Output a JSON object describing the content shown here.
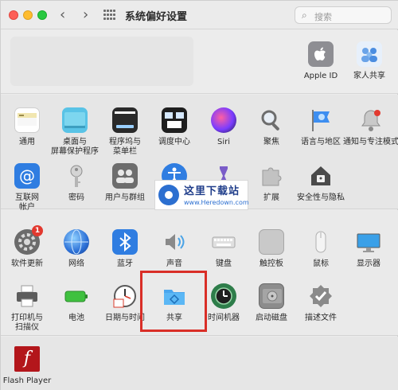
{
  "window": {
    "title": "系统偏好设置",
    "back": "‹",
    "forward": "›"
  },
  "search": {
    "placeholder": "搜索"
  },
  "account": [
    {
      "label": "Apple ID",
      "icon": "apple-icon"
    },
    {
      "label": "家人共享",
      "icon": "family-icon"
    }
  ],
  "row1": [
    {
      "label": "通用",
      "icon": "general-icon"
    },
    {
      "label": "桌面与\n屏幕保护程序",
      "icon": "desktop-icon"
    },
    {
      "label": "程序坞与\n菜单栏",
      "icon": "dock-icon"
    },
    {
      "label": "调度中心",
      "icon": "mission-control-icon"
    },
    {
      "label": "Siri",
      "icon": "siri-icon"
    },
    {
      "label": "聚焦",
      "icon": "spotlight-icon"
    },
    {
      "label": "语言与地区",
      "icon": "flag-icon"
    },
    {
      "label": "通知与专注模式",
      "icon": "bell-icon"
    }
  ],
  "row2": [
    {
      "label": "互联网\n帐户",
      "icon": "at-icon"
    },
    {
      "label": "密码",
      "icon": "key-icon"
    },
    {
      "label": "用户与群组",
      "icon": "users-icon"
    },
    {
      "label": "",
      "icon": "accessibility-icon"
    },
    {
      "label": "",
      "icon": "screen-time-icon"
    },
    {
      "label": "扩展",
      "icon": "puzzle-icon"
    },
    {
      "label": "安全性与隐私",
      "icon": "house-lock-icon"
    }
  ],
  "row3": [
    {
      "label": "软件更新",
      "icon": "gear-icon",
      "badge": "1"
    },
    {
      "label": "网络",
      "icon": "globe-icon"
    },
    {
      "label": "蓝牙",
      "icon": "bluetooth-icon"
    },
    {
      "label": "声音",
      "icon": "speaker-icon"
    },
    {
      "label": "键盘",
      "icon": "keyboard-icon"
    },
    {
      "label": "触控板",
      "icon": "trackpad-icon"
    },
    {
      "label": "鼠标",
      "icon": "mouse-icon"
    },
    {
      "label": "显示器",
      "icon": "display-icon"
    }
  ],
  "row4": [
    {
      "label": "打印机与\n扫描仪",
      "icon": "printer-icon"
    },
    {
      "label": "电池",
      "icon": "battery-icon"
    },
    {
      "label": "日期与时间",
      "icon": "clock-icon"
    },
    {
      "label": "共享",
      "icon": "sharing-folder-icon"
    },
    {
      "label": "时间机器",
      "icon": "time-machine-icon"
    },
    {
      "label": "启动磁盘",
      "icon": "disk-icon"
    },
    {
      "label": "描述文件",
      "icon": "checkmark-badge-icon"
    }
  ],
  "other": [
    {
      "label": "Flash Player",
      "icon": "flash-icon",
      "glyph": "f"
    }
  ],
  "watermark": {
    "title": "这里下载站",
    "sub": "www.Heredown.com"
  },
  "colors": {
    "highlight": "#d92e27",
    "badge": "#e2392f"
  }
}
